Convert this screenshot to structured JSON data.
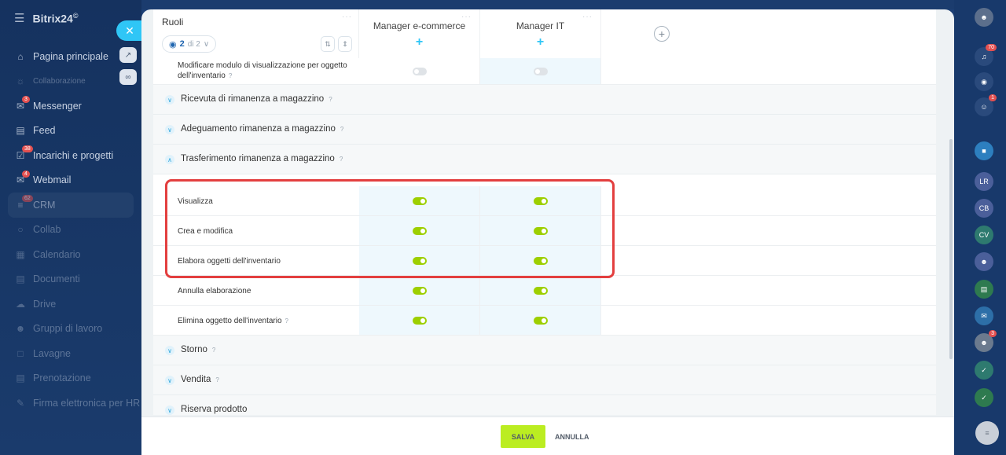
{
  "app": {
    "brand": "Bitrix24",
    "brand_sup": "©"
  },
  "nav": [
    {
      "label": "Pagina principale",
      "icon": "home-icon",
      "badge": ""
    },
    {
      "label": "Collaborazione",
      "icon": "collaboration-icon",
      "badge": ""
    },
    {
      "label": "Messenger",
      "icon": "chat-icon",
      "badge": "3"
    },
    {
      "label": "Feed",
      "icon": "feed-icon",
      "badge": ""
    },
    {
      "label": "Incarichi e progetti",
      "icon": "tasks-icon",
      "badge": "38"
    },
    {
      "label": "Webmail",
      "icon": "mail-icon",
      "badge": "4"
    },
    {
      "label": "CRM",
      "icon": "crm-icon",
      "badge": "62"
    },
    {
      "label": "Collab",
      "icon": "collab-icon",
      "badge": ""
    },
    {
      "label": "Calendario",
      "icon": "calendar-icon",
      "badge": ""
    },
    {
      "label": "Documenti",
      "icon": "documents-icon",
      "badge": ""
    },
    {
      "label": "Drive",
      "icon": "drive-icon",
      "badge": ""
    },
    {
      "label": "Gruppi di lavoro",
      "icon": "groups-icon",
      "badge": ""
    },
    {
      "label": "Lavagne",
      "icon": "board-icon",
      "badge": ""
    },
    {
      "label": "Prenotazione",
      "icon": "booking-icon",
      "badge": ""
    },
    {
      "label": "Firma elettronica per HR",
      "icon": "signature-icon",
      "badge": ""
    }
  ],
  "rail": {
    "notifications_badge": "70",
    "chat_badge": "1",
    "avatars": [
      "LR",
      "CB",
      "CV"
    ],
    "avatar_badge": "3"
  },
  "header": {
    "roles_title": "Ruoli",
    "pager_count": "2",
    "pager_total": "di 2",
    "roles": [
      "Manager e-commerce",
      "Manager IT"
    ]
  },
  "top_row": {
    "label": "Modificare modulo di visualizzazione per oggetto dell'inventario",
    "help": "?"
  },
  "sections": [
    {
      "title": "Ricevuta di rimanenza a magazzino",
      "expanded": false
    },
    {
      "title": "Adeguamento rimanenza a magazzino",
      "expanded": false
    },
    {
      "title": "Trasferimento rimanenza a magazzino",
      "expanded": true
    },
    {
      "title": "Storno",
      "expanded": false
    },
    {
      "title": "Vendita",
      "expanded": false
    },
    {
      "title": "Riserva prodotto",
      "expanded": false
    }
  ],
  "permissions": [
    {
      "label": "Visualizza",
      "help": "",
      "mgr1": true,
      "mgr2": true
    },
    {
      "label": "Crea e modifica",
      "help": "",
      "mgr1": true,
      "mgr2": true
    },
    {
      "label": "Elabora oggetti dell'inventario",
      "help": "",
      "mgr1": true,
      "mgr2": true
    },
    {
      "label": "Annulla elaborazione",
      "help": "",
      "mgr1": true,
      "mgr2": true
    },
    {
      "label": "Elimina oggetto dell'inventario",
      "help": "?",
      "mgr1": true,
      "mgr2": true
    }
  ],
  "footer": {
    "save": "SALVA",
    "cancel": "ANNULLA"
  },
  "colors": {
    "toggle_on": "#9dcf00",
    "save": "#bbed21",
    "highlight": "#e33f3f",
    "accent": "#2fc6f6"
  }
}
